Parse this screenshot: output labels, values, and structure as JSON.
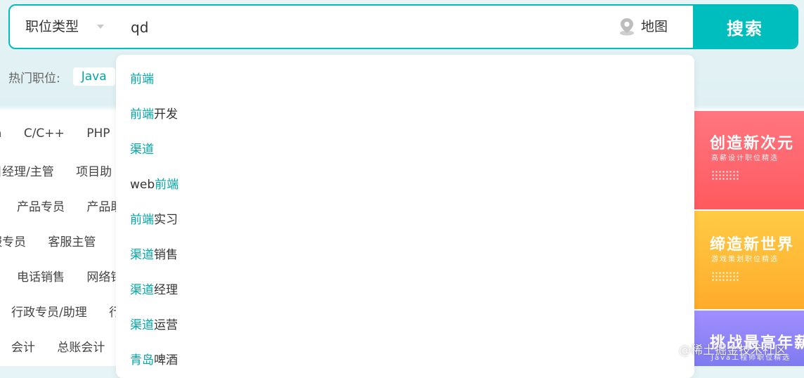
{
  "search": {
    "job_type_label": "职位类型",
    "query": "qd",
    "map_label": "地图",
    "submit_label": "搜索"
  },
  "hot_jobs": {
    "label": "热门职位:",
    "tags": [
      "Java"
    ]
  },
  "categories": [
    [
      "a",
      "C/C++",
      "PHP"
    ],
    [
      "目经理/主管",
      "项目助"
    ],
    [
      "产品专员",
      "产品助"
    ],
    [
      "服专员",
      "客服主管"
    ],
    [
      "电话销售",
      "网络销"
    ],
    [
      "行政专员/助理",
      "行"
    ],
    [
      "会计",
      "总账会计"
    ]
  ],
  "suggestions": [
    {
      "hl": "前端",
      "rest": "",
      "prefix": ""
    },
    {
      "hl": "前端",
      "rest": "开发",
      "prefix": ""
    },
    {
      "hl": "渠道",
      "rest": "",
      "prefix": ""
    },
    {
      "hl": "前端",
      "rest": "",
      "prefix": "web"
    },
    {
      "hl": "前端",
      "rest": "实习",
      "prefix": ""
    },
    {
      "hl": "渠道",
      "rest": "销售",
      "prefix": ""
    },
    {
      "hl": "渠道",
      "rest": "经理",
      "prefix": ""
    },
    {
      "hl": "渠道",
      "rest": "运营",
      "prefix": ""
    },
    {
      "hl": "青岛",
      "rest": "啤酒",
      "prefix": ""
    }
  ],
  "banners": [
    {
      "title": "创造新次元",
      "subtitle": "高薪设计职位精选",
      "color_top": "#ff6f7a",
      "color_bottom": "#ff5b5f"
    },
    {
      "title": "缔造新世界",
      "subtitle": "游戏策划职位精选",
      "color_top": "#ffc53a",
      "color_bottom": "#ffa928"
    },
    {
      "title": "挑战最高年薪",
      "subtitle": "Java工程师职位精选",
      "color_top": "#9b8cff",
      "color_bottom": "#7d79f2"
    }
  ],
  "watermark": "@稀土掘金技术社区",
  "colors": {
    "accent": "#00bebd",
    "highlight": "#00a6a7"
  }
}
